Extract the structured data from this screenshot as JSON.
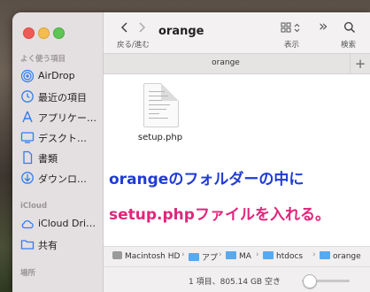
{
  "window": {
    "title": "orange",
    "tab_title": "orange",
    "tab_plus": "+"
  },
  "toolbar": {
    "back_forward_label": "戻る/進む",
    "view_label": "表示",
    "search_label": "検索",
    "more_symbol": "»"
  },
  "sidebar": {
    "favorites_header": "よく使う項目",
    "favorites": [
      {
        "label": "AirDrop",
        "icon": "airdrop-icon"
      },
      {
        "label": "最近の項目",
        "icon": "clock-icon"
      },
      {
        "label": "アプリケー…",
        "icon": "applications-icon"
      },
      {
        "label": "デスクト…",
        "icon": "desktop-icon"
      },
      {
        "label": "書類",
        "icon": "document-icon"
      },
      {
        "label": "ダウンロ…",
        "icon": "download-icon"
      }
    ],
    "icloud_header": "iCloud",
    "icloud": [
      {
        "label": "iCloud Dri…",
        "icon": "cloud-icon"
      },
      {
        "label": "共有",
        "icon": "shared-folder-icon"
      }
    ],
    "locations_header": "場所"
  },
  "files": [
    {
      "name": "setup.php"
    }
  ],
  "annotation": {
    "line1": "orangeのフォルダーの中に",
    "line2": "setup.phpファイルを入れる。",
    "line1_color": "#1f3bd6",
    "line2_color": "#e0267a"
  },
  "path_bar": {
    "items": [
      "Macintosh HD",
      "アプ",
      "MA",
      "htdocs",
      "orange"
    ]
  },
  "status": {
    "text": "1 項目、805.14 GB 空き",
    "zoom_level": 0.15
  }
}
